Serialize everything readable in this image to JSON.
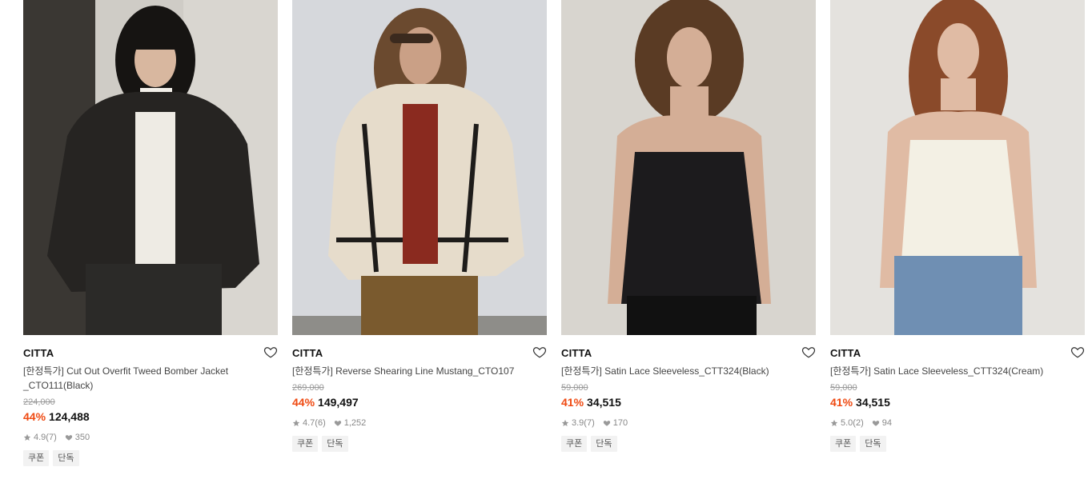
{
  "products": [
    {
      "brand": "CITTA",
      "name": "[한정특가] Cut Out Overfit Tweed Bomber Jacket _CTO111(Black)",
      "original_price": "224,000",
      "discount": "44%",
      "price": "124,488",
      "rating": "4.9",
      "review_count": "(7)",
      "likes": "350",
      "tags": [
        "쿠폰",
        "단독"
      ],
      "image": "model-black-tweed-jacket"
    },
    {
      "brand": "CITTA",
      "name": "[한정특가] Reverse Shearing Line Mustang_CTO107",
      "original_price": "269,000",
      "discount": "44%",
      "price": "149,497",
      "rating": "4.7",
      "review_count": "(6)",
      "likes": "1,252",
      "tags": [
        "쿠폰",
        "단독"
      ],
      "image": "model-cream-shearling-jacket"
    },
    {
      "brand": "CITTA",
      "name": "[한정특가] Satin Lace Sleeveless_CTT324(Black)",
      "original_price": "59,000",
      "discount": "41%",
      "price": "34,515",
      "rating": "3.9",
      "review_count": "(7)",
      "likes": "170",
      "tags": [
        "쿠폰",
        "단독"
      ],
      "image": "model-black-satin-camisole"
    },
    {
      "brand": "CITTA",
      "name": "[한정특가] Satin Lace Sleeveless_CTT324(Cream)",
      "original_price": "59,000",
      "discount": "41%",
      "price": "34,515",
      "rating": "5.0",
      "review_count": "(2)",
      "likes": "94",
      "tags": [
        "쿠폰",
        "단독"
      ],
      "image": "model-cream-satin-camisole"
    }
  ],
  "icons": {
    "wishlist": "heart-outline-icon",
    "rating": "star-icon",
    "likes": "heart-filled-icon"
  },
  "colors": {
    "discount": "#ef4a12",
    "tag_background": "#f2f2f2",
    "original_price": "#999999"
  }
}
